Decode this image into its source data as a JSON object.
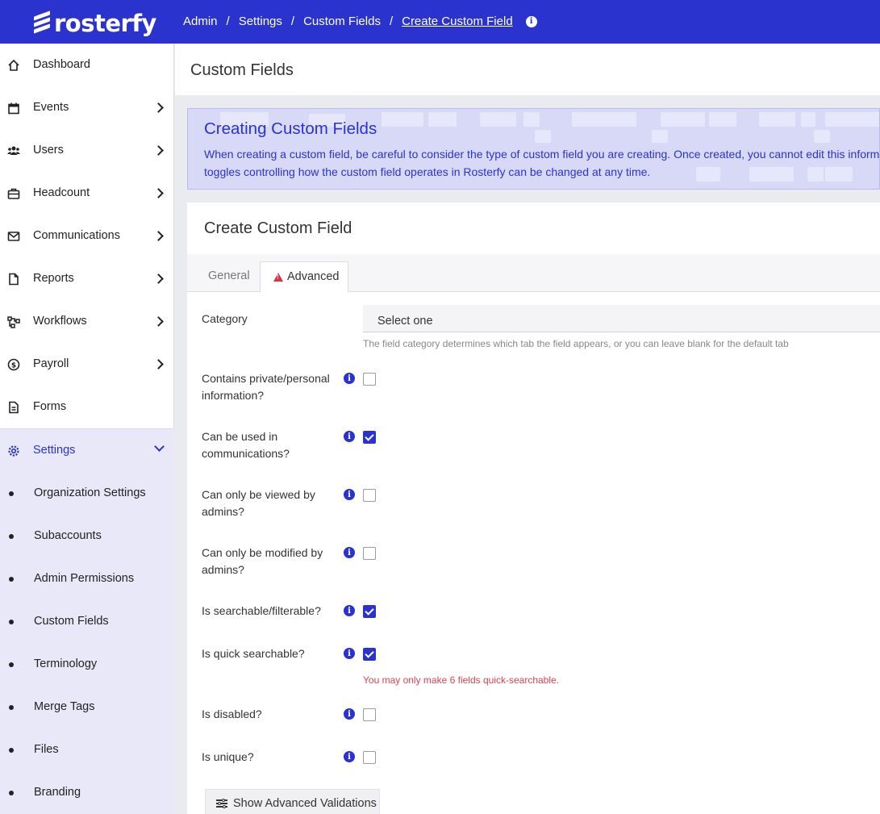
{
  "brand": {
    "name": "rosterfy",
    "primary_color": "#2b33cf",
    "error_color": "#e0404f"
  },
  "breadcrumb": {
    "items": [
      "Admin",
      "Settings",
      "Custom Fields",
      "Create Custom Field"
    ],
    "separator": "/",
    "info_icon": "info-icon"
  },
  "sidebar": {
    "items": [
      {
        "label": "Dashboard",
        "icon": "home-icon"
      },
      {
        "label": "Events",
        "icon": "calendar-icon"
      },
      {
        "label": "Users",
        "icon": "users-icon"
      },
      {
        "label": "Headcount",
        "icon": "briefcase-icon"
      },
      {
        "label": "Communications",
        "icon": "mail-icon"
      },
      {
        "label": "Reports",
        "icon": "file-icon"
      },
      {
        "label": "Workflows",
        "icon": "workflow-icon"
      },
      {
        "label": "Payroll",
        "icon": "dollar-icon"
      },
      {
        "label": "Forms",
        "icon": "document-icon"
      }
    ],
    "settings": {
      "label": "Settings",
      "icon": "gear-icon",
      "children": [
        "Organization Settings",
        "Subaccounts",
        "Admin Permissions",
        "Custom Fields",
        "Terminology",
        "Merge Tags",
        "Files",
        "Branding"
      ]
    }
  },
  "page": {
    "title": "Custom Fields"
  },
  "banner": {
    "title": "Creating Custom Fields",
    "line1": "When creating a custom field, be careful to consider the type of custom field you are creating. Once created, you cannot edit this informati",
    "line2": "toggles controlling how the custom field operates in Rosterfy can be changed at any time."
  },
  "form": {
    "title": "Create Custom Field",
    "tabs": [
      {
        "label": "General",
        "active": false
      },
      {
        "label": "Advanced",
        "active": true,
        "icon": "warning-icon"
      }
    ],
    "category": {
      "label": "Category",
      "value": "Select one",
      "help": "The field category determines which tab the field appears, or you can leave blank for the default tab"
    },
    "options": [
      {
        "label": "Contains private/personal information?",
        "checked": false
      },
      {
        "label": "Can be used in communications?",
        "checked": true
      },
      {
        "label": "Can only be viewed by admins?",
        "checked": false
      },
      {
        "label": "Can only be modified by admins?",
        "checked": false
      },
      {
        "label": "Is searchable/filterable?",
        "checked": true
      },
      {
        "label": "Is quick searchable?",
        "checked": true,
        "error": "You may only make 6 fields quick-searchable."
      },
      {
        "label": "Is disabled?",
        "checked": false
      },
      {
        "label": "Is unique?",
        "checked": false
      }
    ],
    "advanced_button": {
      "label": "Show Advanced Validations",
      "icon": "sliders-icon"
    }
  }
}
